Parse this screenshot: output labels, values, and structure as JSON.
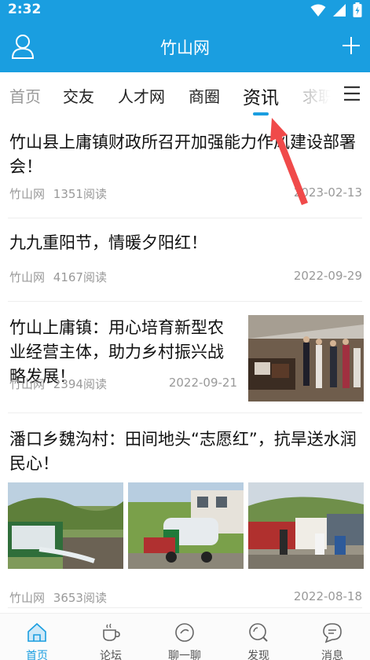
{
  "status_bar": {
    "time": "2:32"
  },
  "app_bar": {
    "title": "竹山网",
    "icons": [
      "user-icon",
      "plus-icon"
    ]
  },
  "tabs": [
    {
      "label": "首页"
    },
    {
      "label": "交友"
    },
    {
      "label": "人才网"
    },
    {
      "label": "商圈"
    },
    {
      "label": "资讯",
      "active": true
    },
    {
      "label": "求职"
    }
  ],
  "articles": [
    {
      "title": "竹山县上庸镇财政所召开加强能力作风建设部署会！",
      "source": "竹山网",
      "reads": "1351阅读",
      "date": "2023-02-13"
    },
    {
      "title": "九九重阳节，情暖夕阳红！",
      "source": "竹山网",
      "reads": "4167阅读",
      "date": "2022-09-29"
    },
    {
      "title": "竹山上庸镇：用心培育新型农业经营主体，助力乡村振兴战略发展！",
      "source": "竹山网",
      "reads": "2394阅读",
      "date": "2022-09-21"
    },
    {
      "title": "潘口乡魏沟村：田间地头“志愿红”，抗旱送水润民心！",
      "source": "竹山网",
      "reads": "3653阅读",
      "date": "2022-08-18"
    }
  ],
  "bottom_nav": [
    {
      "label": "首页",
      "icon": "home-icon",
      "active": true
    },
    {
      "label": "论坛",
      "icon": "coffee-cup-icon"
    },
    {
      "label": "聊一聊",
      "icon": "chat-circle-icon"
    },
    {
      "label": "发现",
      "icon": "discover-icon"
    },
    {
      "label": "消息",
      "icon": "message-icon"
    }
  ],
  "colors": {
    "brand": "#1a9ee0",
    "annotation_arrow": "#f04a4a"
  }
}
